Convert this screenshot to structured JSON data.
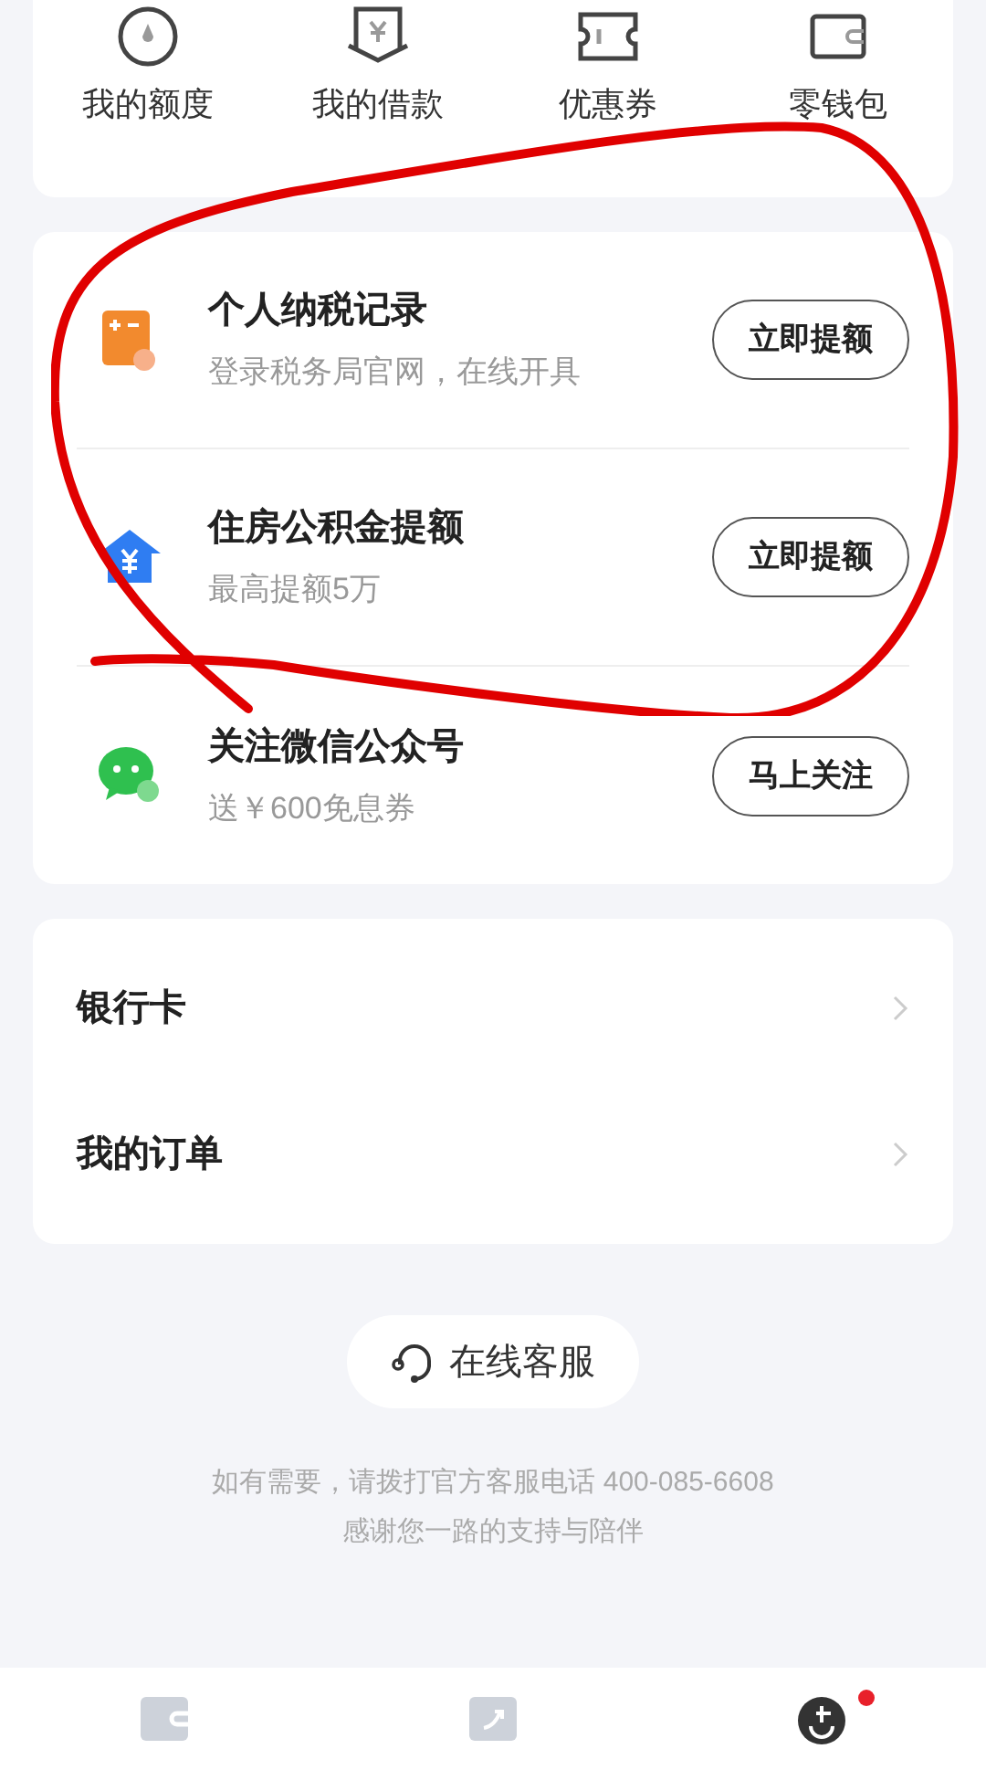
{
  "shortcuts": [
    {
      "kind": "quota",
      "label": "我的额度"
    },
    {
      "kind": "loan",
      "label": "我的借款"
    },
    {
      "kind": "coupon",
      "label": "优惠券"
    },
    {
      "kind": "wallet",
      "label": "零钱包"
    }
  ],
  "tasks": [
    {
      "kind": "tax",
      "title": "个人纳税记录",
      "subtitle": "登录税务局官网，在线开具",
      "action": "立即提额"
    },
    {
      "kind": "fund",
      "title": "住房公积金提额",
      "subtitle": "最高提额5万",
      "action": "立即提额"
    },
    {
      "kind": "wechat",
      "title": "关注微信公众号",
      "subtitle": "送￥600免息券",
      "action": "马上关注"
    }
  ],
  "links": [
    {
      "label": "银行卡"
    },
    {
      "label": "我的订单"
    }
  ],
  "service_button": "在线客服",
  "footer": [
    "如有需要，请拨打官方客服电话 400-085-6608",
    "感谢您一路的支持与陪伴"
  ],
  "bottom_nav": [
    {
      "kind": "home",
      "selected": false,
      "badge": false
    },
    {
      "kind": "boost",
      "selected": false,
      "badge": false
    },
    {
      "kind": "me",
      "selected": true,
      "badge": true
    }
  ]
}
